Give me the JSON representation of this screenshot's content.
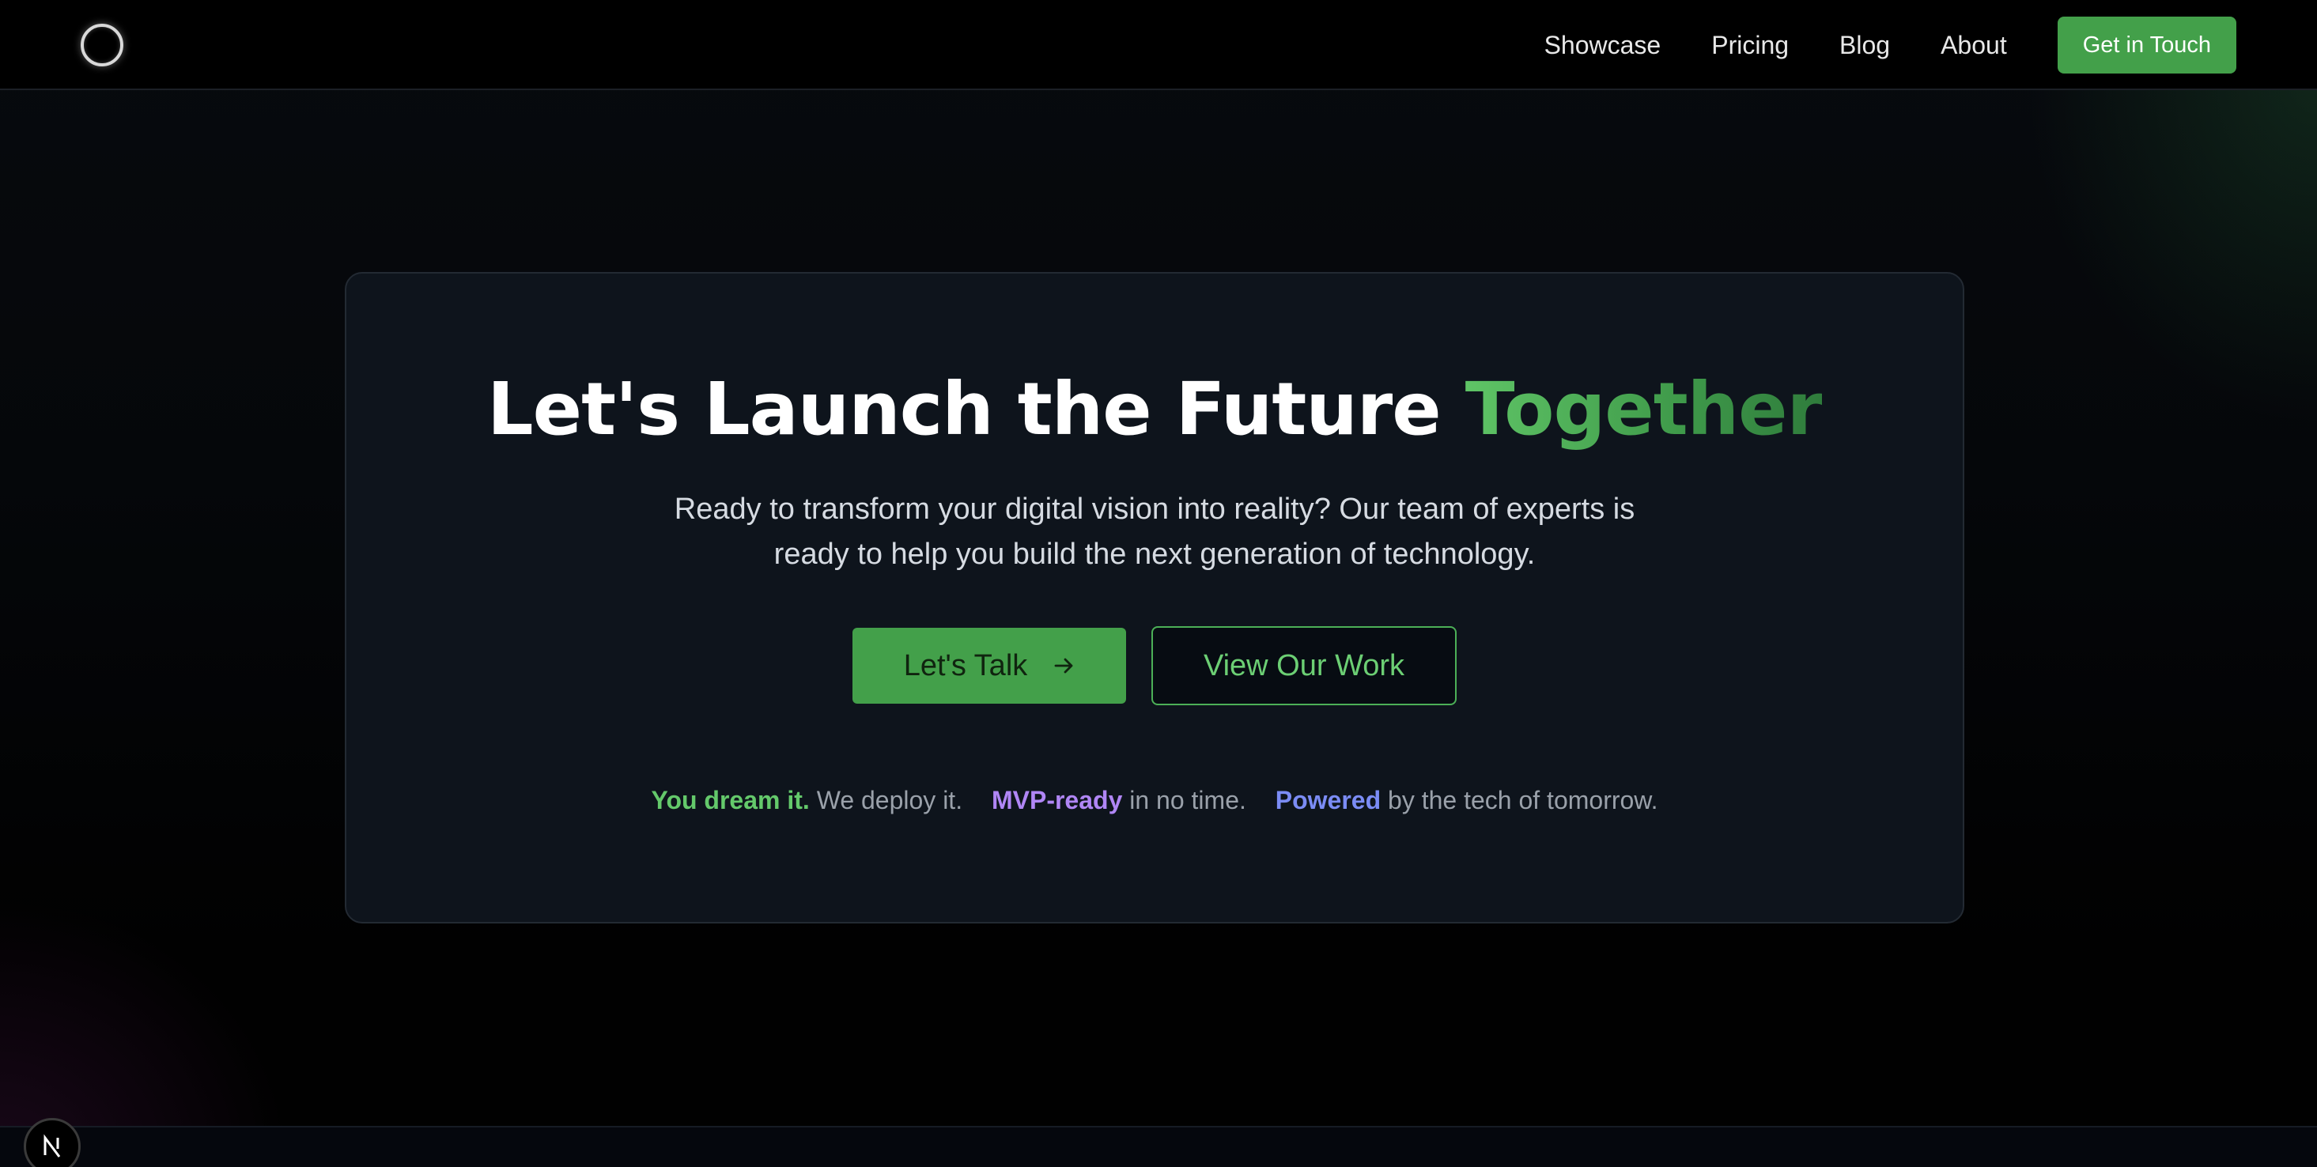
{
  "nav": {
    "links": [
      "Showcase",
      "Pricing",
      "Blog",
      "About"
    ],
    "cta_label": "Get in Touch"
  },
  "hero": {
    "title_main": "Let's Launch the Future",
    "title_accent": "Together",
    "subtitle": "Ready to transform your digital vision into reality? Our team of experts is ready to help you build the next generation of technology.",
    "primary_button": "Let's Talk",
    "primary_button_icon": "arrow-right-icon",
    "secondary_button": "View Our Work",
    "tagline": {
      "part1_highlight": "You dream it.",
      "part1_rest": "We deploy it.",
      "part2_highlight": "MVP-ready",
      "part2_rest": "in no time.",
      "part3_highlight": "Powered",
      "part3_rest": "by the tech of tomorrow."
    }
  },
  "dev_badge": {
    "icon": "nextjs-icon"
  },
  "colors": {
    "accent_green": "#43a04a",
    "highlight_green": "#64c96b",
    "highlight_purple": "#b086f5",
    "highlight_blue": "#7b8cf5",
    "card_background": "#0e141c"
  }
}
